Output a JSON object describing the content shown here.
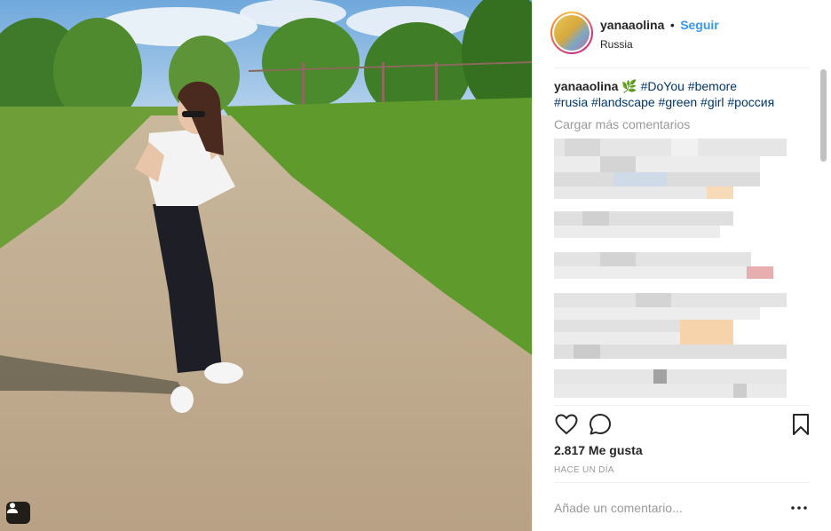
{
  "post": {
    "username": "yanaaolina",
    "follow_separator": "•",
    "follow_label": "Seguir",
    "location": "Russia"
  },
  "caption": {
    "username": "yanaaolina",
    "emoji": "🌿",
    "hashtags": [
      "#DoYou",
      "#bemore",
      "#rusia",
      "#landscape",
      "#green",
      "#girl",
      "#россия"
    ]
  },
  "comments": {
    "load_more_label": "Cargar más comentarios"
  },
  "engagement": {
    "likes_label": "2.817 Me gusta",
    "timestamp": "HACE UN DÍA"
  },
  "composer": {
    "placeholder": "Añade un comentario...",
    "more_label": "•••"
  },
  "icons": {
    "like": "heart-icon",
    "comment": "comment-bubble-icon",
    "save": "bookmark-icon",
    "tag": "user-tag-icon"
  },
  "colors": {
    "link_blue": "#3897f0",
    "hashtag": "#003569",
    "muted": "#999999",
    "text": "#262626"
  }
}
